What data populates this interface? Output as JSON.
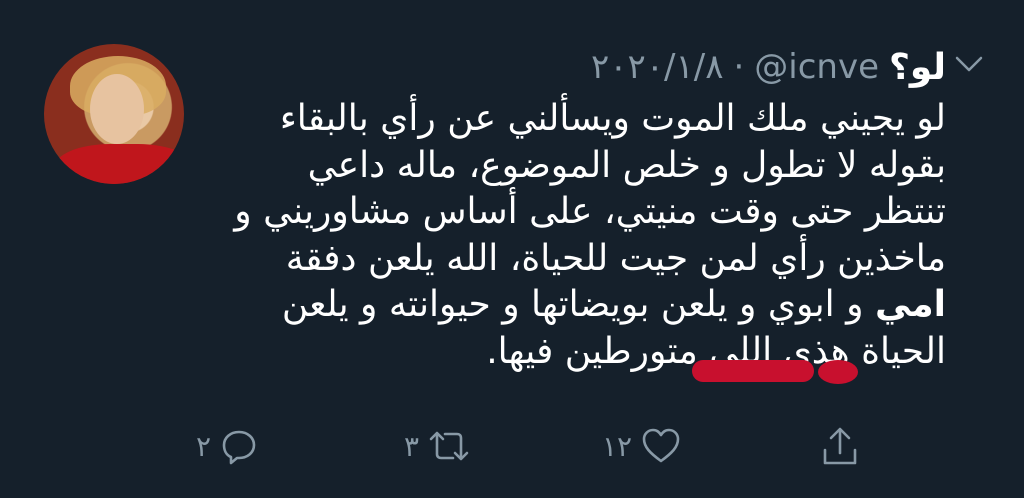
{
  "tweet": {
    "display_name": "لو؟",
    "handle": "@icnve",
    "separator": "·",
    "date": "٢٠٢٠/١/٨",
    "text_lines": [
      "لو يجيني ملك الموت ويسألني عن رأي بالبقاء",
      "بقوله لا تطول و خلص الموضوع، ماله داعي",
      "تنتظر حتى وقت منيتي، على أساس مشاوريني و",
      "ماخذين رأي لمن جيت للحياة، الله يلعن دفقة",
      "و ابوي و يلعن بويضاتها و حيوانته و يلعن",
      "الحياة هذي اللي متورطين فيها."
    ],
    "bold_word": "امي",
    "counts": {
      "replies": "٢",
      "retweets": "٣",
      "likes": "١٢"
    }
  },
  "colors": {
    "background": "#15202b",
    "text": "#ffffff",
    "muted": "#8899a6",
    "redaction": "#c8102e"
  },
  "icons": {
    "reply": "reply-icon",
    "retweet": "retweet-icon",
    "like": "heart-icon",
    "share": "share-icon",
    "menu": "chevron-down-icon"
  }
}
